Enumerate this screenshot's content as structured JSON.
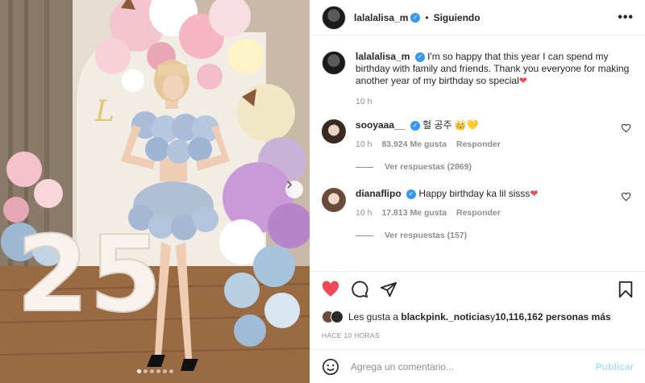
{
  "post": {
    "username": "lalalalisa_m",
    "follow_status": "Siguiendo",
    "separator": "•",
    "more_label": "•••",
    "image_dots": 6,
    "active_dot": 0
  },
  "caption": {
    "username": "lalalalisa_m",
    "text": "I'm so happy that this year I can spend my birthday with family and friends. Thank you everyone for making another year of my birthday so special",
    "emoji": "❤",
    "time": "10 h"
  },
  "comments": [
    {
      "username": "sooyaaa__",
      "text": "헐 공주 ",
      "emoji": "👑💛",
      "time": "10 h",
      "likes": "83.924 Me gusta",
      "reply_label": "Responder",
      "view_replies": "Ver respuestas (2869)"
    },
    {
      "username": "dianaflipo",
      "text": "Happy birthday ka lil sisss",
      "emoji": "❤",
      "time": "10 h",
      "likes": "17.813 Me gusta",
      "reply_label": "Responder",
      "view_replies": "Ver respuestas (157)"
    }
  ],
  "likes": {
    "prefix": "Les gusta a ",
    "user": "blackpink._noticias",
    "middle": " y ",
    "count": "10,116,162 personas más"
  },
  "timestamp": "HACE 10 HORAS",
  "composer": {
    "placeholder": "Agrega un comentario...",
    "publish_label": "Publicar"
  },
  "photo": {
    "number_label": "25",
    "letter_label": "L"
  },
  "colors": {
    "heart": "#ed4956",
    "verified": "#3897f0",
    "publish_disabled": "#b2dffc"
  }
}
